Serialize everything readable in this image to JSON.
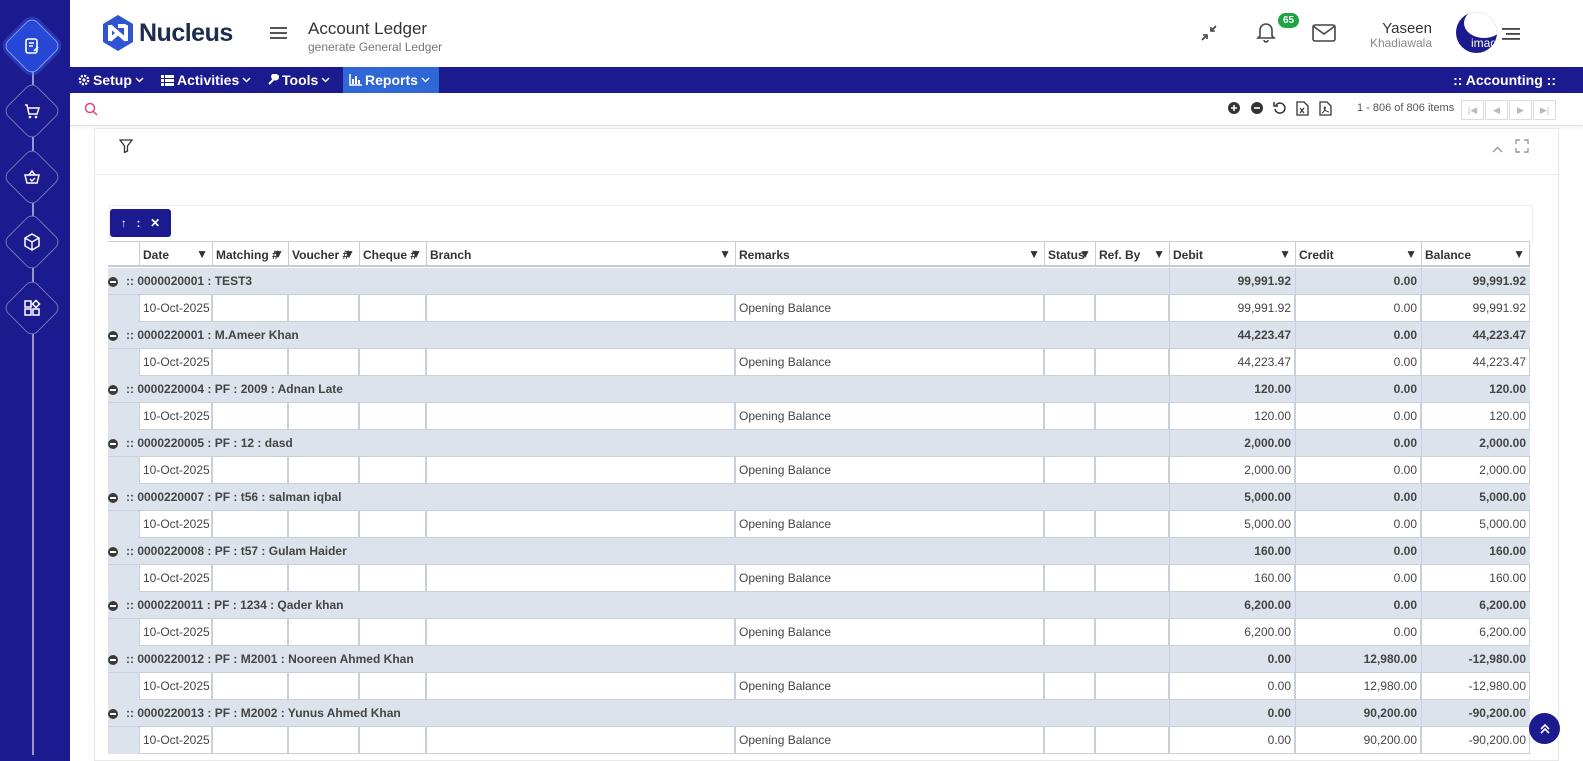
{
  "app": {
    "brand": "Nucleus",
    "page_title": "Account Ledger",
    "page_subtitle": "generate General Ledger"
  },
  "header": {
    "notification_count": "65",
    "user_name": "Yaseen",
    "user_sub": "Khadiawala",
    "avatar_alt": "imag"
  },
  "menu": {
    "items": [
      "Setup",
      "Activities",
      "Tools",
      "Reports"
    ],
    "active": "Reports",
    "module": ":: Accounting ::"
  },
  "toolbar": {
    "search_placeholder": "",
    "pager_info": "1 - 806 of 806 items"
  },
  "grouping": {
    "chip_label": ":"
  },
  "grid": {
    "columns": [
      "Date",
      "Matching #",
      "Voucher #",
      "Cheque #",
      "Branch",
      "Remarks",
      "Status",
      "Ref. By",
      "Debit",
      "Credit",
      "Balance"
    ],
    "groups": [
      {
        "title": ":: 0000020001 : TEST3",
        "debit": "99,991.92",
        "credit": "0.00",
        "balance": "99,991.92",
        "row": {
          "date": "10-Oct-2025",
          "remarks": "Opening Balance",
          "debit": "99,991.92",
          "credit": "0.00",
          "balance": "99,991.92"
        }
      },
      {
        "title": ":: 0000220001 : M.Ameer Khan",
        "debit": "44,223.47",
        "credit": "0.00",
        "balance": "44,223.47",
        "row": {
          "date": "10-Oct-2025",
          "remarks": "Opening Balance",
          "debit": "44,223.47",
          "credit": "0.00",
          "balance": "44,223.47"
        }
      },
      {
        "title": ":: 0000220004 : PF : 2009 : Adnan Late",
        "debit": "120.00",
        "credit": "0.00",
        "balance": "120.00",
        "row": {
          "date": "10-Oct-2025",
          "remarks": "Opening Balance",
          "debit": "120.00",
          "credit": "0.00",
          "balance": "120.00"
        }
      },
      {
        "title": ":: 0000220005 : PF : 12 : dasd",
        "debit": "2,000.00",
        "credit": "0.00",
        "balance": "2,000.00",
        "row": {
          "date": "10-Oct-2025",
          "remarks": "Opening Balance",
          "debit": "2,000.00",
          "credit": "0.00",
          "balance": "2,000.00"
        }
      },
      {
        "title": ":: 0000220007 : PF : t56 : salman iqbal",
        "debit": "5,000.00",
        "credit": "0.00",
        "balance": "5,000.00",
        "row": {
          "date": "10-Oct-2025",
          "remarks": "Opening Balance",
          "debit": "5,000.00",
          "credit": "0.00",
          "balance": "5,000.00"
        }
      },
      {
        "title": ":: 0000220008 : PF : t57 : Gulam Haider",
        "debit": "160.00",
        "credit": "0.00",
        "balance": "160.00",
        "row": {
          "date": "10-Oct-2025",
          "remarks": "Opening Balance",
          "debit": "160.00",
          "credit": "0.00",
          "balance": "160.00"
        }
      },
      {
        "title": ":: 0000220011 : PF : 1234 : Qader khan",
        "debit": "6,200.00",
        "credit": "0.00",
        "balance": "6,200.00",
        "row": {
          "date": "10-Oct-2025",
          "remarks": "Opening Balance",
          "debit": "6,200.00",
          "credit": "0.00",
          "balance": "6,200.00"
        }
      },
      {
        "title": ":: 0000220012 : PF : M2001 : Nooreen Ahmed Khan",
        "debit": "0.00",
        "credit": "12,980.00",
        "balance": "-12,980.00",
        "row": {
          "date": "10-Oct-2025",
          "remarks": "Opening Balance",
          "debit": "0.00",
          "credit": "12,980.00",
          "balance": "-12,980.00"
        }
      },
      {
        "title": ":: 0000220013 : PF : M2002 : Yunus Ahmed Khan",
        "debit": "0.00",
        "credit": "90,200.00",
        "balance": "-90,200.00",
        "row": {
          "date": "10-Oct-2025",
          "remarks": "Opening Balance",
          "debit": "0.00",
          "credit": "90,200.00",
          "balance": "-90,200.00"
        }
      }
    ]
  }
}
